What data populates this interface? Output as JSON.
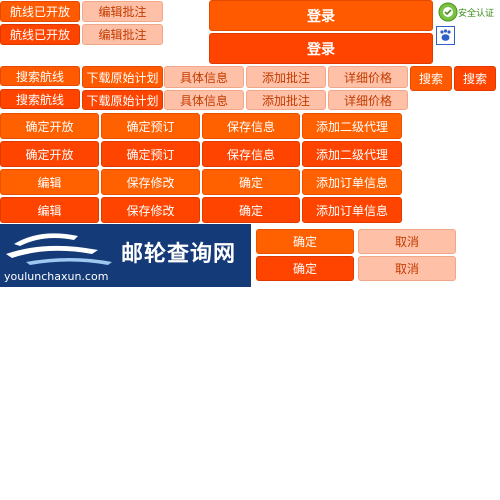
{
  "colors": {
    "orange_primary": "#ff5a00",
    "orange_deep": "#ff4400",
    "pink_light": "#ffc0a8",
    "navy_banner": "#143a78"
  },
  "buttons": {
    "route_open": "航线已开放",
    "edit_note": "编辑批注",
    "login": "登录",
    "security_cert": "安全认证",
    "search_route": "搜索航线",
    "download_plan": "下载原始计划",
    "details": "具体信息",
    "add_note": "添加批注",
    "price_details": "详细价格",
    "search": "搜索",
    "confirm_open": "确定开放",
    "confirm_booking": "确定预订",
    "save_info": "保存信息",
    "add_agent": "添加二级代理",
    "edit": "编辑",
    "save_changes": "保存修改",
    "confirm": "确定",
    "add_order": "添加订单信息",
    "cancel": "取消"
  },
  "banner": {
    "site_name": "邮轮查询网",
    "domain": "youlunchaxun.com"
  },
  "icons": {
    "security": "security-badge-icon",
    "baidu": "baidu-paw-icon",
    "logo": "ship-wave-logo-icon"
  }
}
